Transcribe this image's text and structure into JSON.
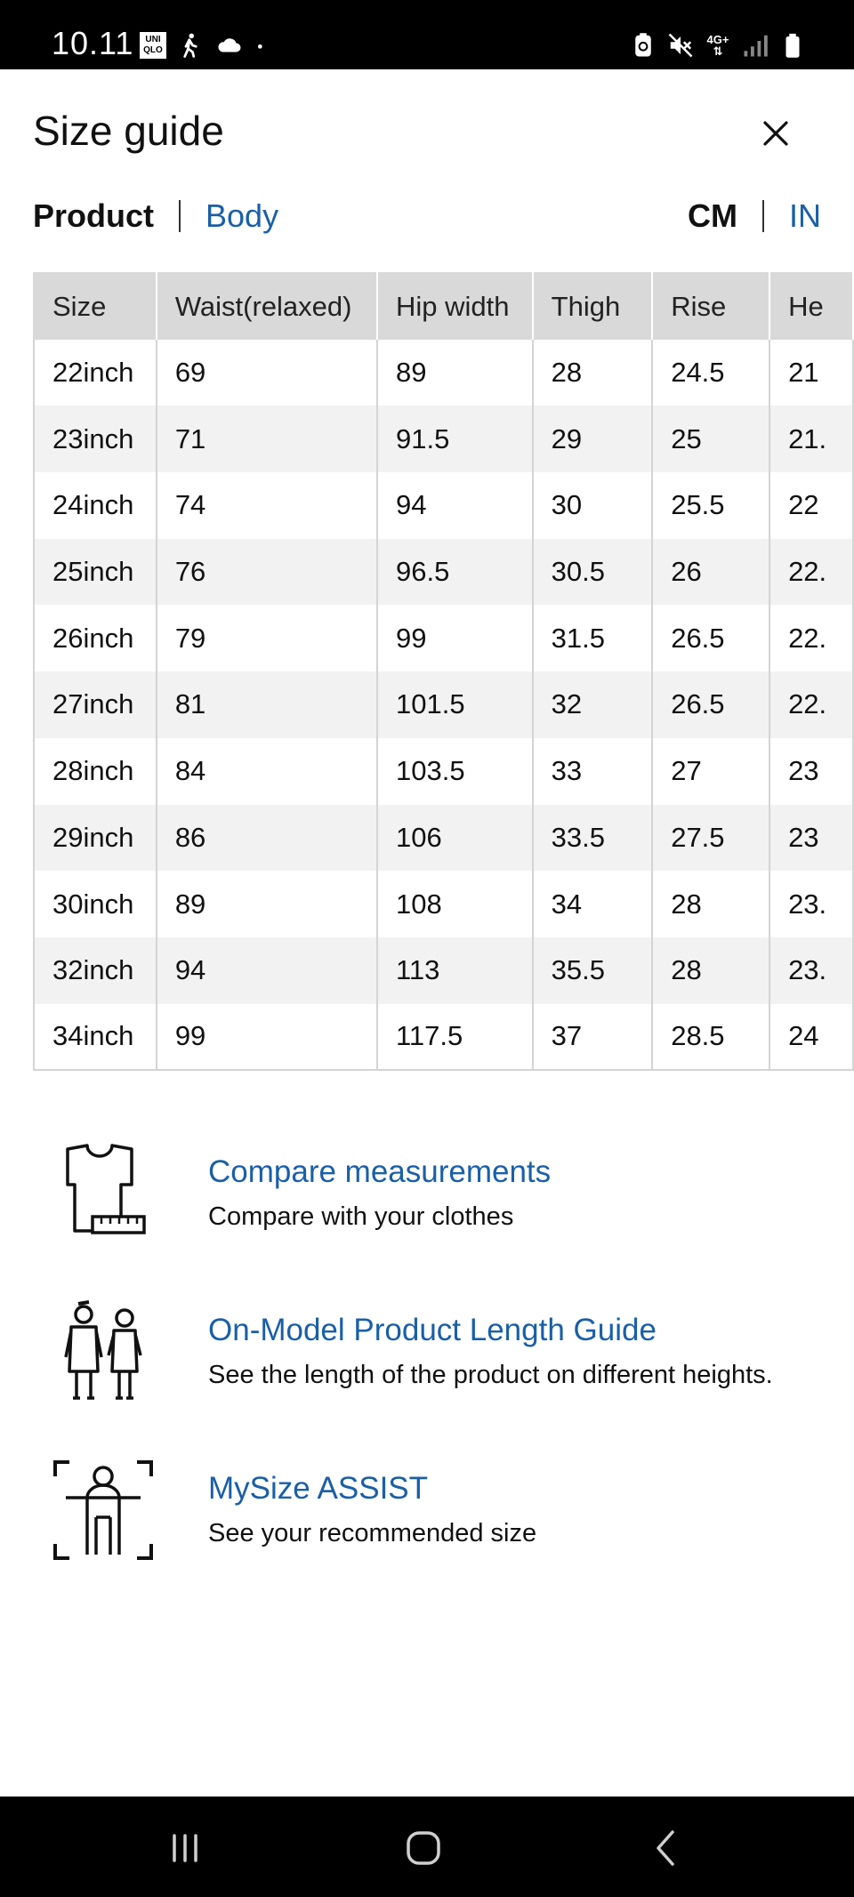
{
  "status_bar": {
    "time": "10.11",
    "app_logo_text": "UNI QLO",
    "left_icons": [
      "uniqlo-icon",
      "walking-icon",
      "cloud-icon",
      "dot-icon"
    ],
    "right_icons": [
      "battery-saver-icon",
      "mute-icon",
      "network-4g-icon",
      "signal-icon",
      "battery-icon"
    ],
    "network_label": "4G+"
  },
  "header": {
    "title": "Size guide"
  },
  "toggles": {
    "measure": {
      "product": "Product",
      "body": "Body",
      "active": "Product"
    },
    "unit": {
      "cm": "CM",
      "in": "IN",
      "active": "CM"
    }
  },
  "table": {
    "columns": [
      "Size",
      "Waist(relaxed)",
      "Hip width",
      "Thigh",
      "Rise",
      "He"
    ],
    "rows": [
      [
        "22inch",
        "69",
        "89",
        "28",
        "24.5",
        "21"
      ],
      [
        "23inch",
        "71",
        "91.5",
        "29",
        "25",
        "21."
      ],
      [
        "24inch",
        "74",
        "94",
        "30",
        "25.5",
        "22"
      ],
      [
        "25inch",
        "76",
        "96.5",
        "30.5",
        "26",
        "22."
      ],
      [
        "26inch",
        "79",
        "99",
        "31.5",
        "26.5",
        "22."
      ],
      [
        "27inch",
        "81",
        "101.5",
        "32",
        "26.5",
        "22."
      ],
      [
        "28inch",
        "84",
        "103.5",
        "33",
        "27",
        "23"
      ],
      [
        "29inch",
        "86",
        "106",
        "33.5",
        "27.5",
        "23"
      ],
      [
        "30inch",
        "89",
        "108",
        "34",
        "28",
        "23."
      ],
      [
        "32inch",
        "94",
        "113",
        "35.5",
        "28",
        "23."
      ],
      [
        "34inch",
        "99",
        "117.5",
        "37",
        "28.5",
        "24"
      ]
    ]
  },
  "features": [
    {
      "icon": "tshirt-ruler-icon",
      "title": "Compare measurements",
      "description": "Compare with your clothes"
    },
    {
      "icon": "models-icon",
      "title": "On-Model Product Length Guide",
      "description": "See the length of the product on different heights."
    },
    {
      "icon": "body-scan-icon",
      "title": "MySize ASSIST",
      "description": "See your recommended size"
    }
  ],
  "nav_bar": {
    "buttons": [
      "recents-icon",
      "home-icon",
      "back-icon"
    ]
  },
  "colors": {
    "link": "#1a5fa8",
    "header_bg": "#d9d9d9",
    "stripe": "#f2f2f2",
    "bars": "#000000"
  }
}
